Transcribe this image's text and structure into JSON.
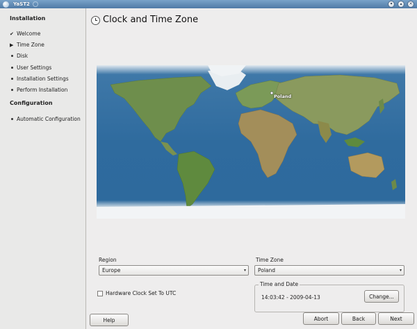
{
  "window": {
    "title": "YaST2"
  },
  "sidebar": {
    "installation_heading": "Installation",
    "installation_items": [
      {
        "label": "Welcome",
        "state": "done"
      },
      {
        "label": "Time Zone",
        "state": "current"
      },
      {
        "label": "Disk",
        "state": "pending"
      },
      {
        "label": "User Settings",
        "state": "pending"
      },
      {
        "label": "Installation Settings",
        "state": "pending"
      },
      {
        "label": "Perform Installation",
        "state": "pending"
      }
    ],
    "configuration_heading": "Configuration",
    "configuration_items": [
      {
        "label": "Automatic Configuration",
        "state": "pending"
      }
    ]
  },
  "page": {
    "title": "Clock and Time Zone",
    "icon": "clock-icon"
  },
  "map": {
    "highlight_label": "Poland"
  },
  "form": {
    "region_label": "Region",
    "region_value": "Europe",
    "timezone_label": "Time Zone",
    "timezone_value": "Poland",
    "hwclock_label": "Hardware Clock Set To UTC",
    "hwclock_checked": false,
    "time_group_label": "Time and Date",
    "time_value": "14:03:42 - 2009-04-13",
    "change_button": "Change..."
  },
  "footer": {
    "help_button": "Help",
    "abort_button": "Abort",
    "back_button": "Back",
    "next_button": "Next"
  },
  "colors": {
    "titlebar": "#5b86b2",
    "ocean": "#2f6b9e",
    "land": "#6d8d4a"
  }
}
